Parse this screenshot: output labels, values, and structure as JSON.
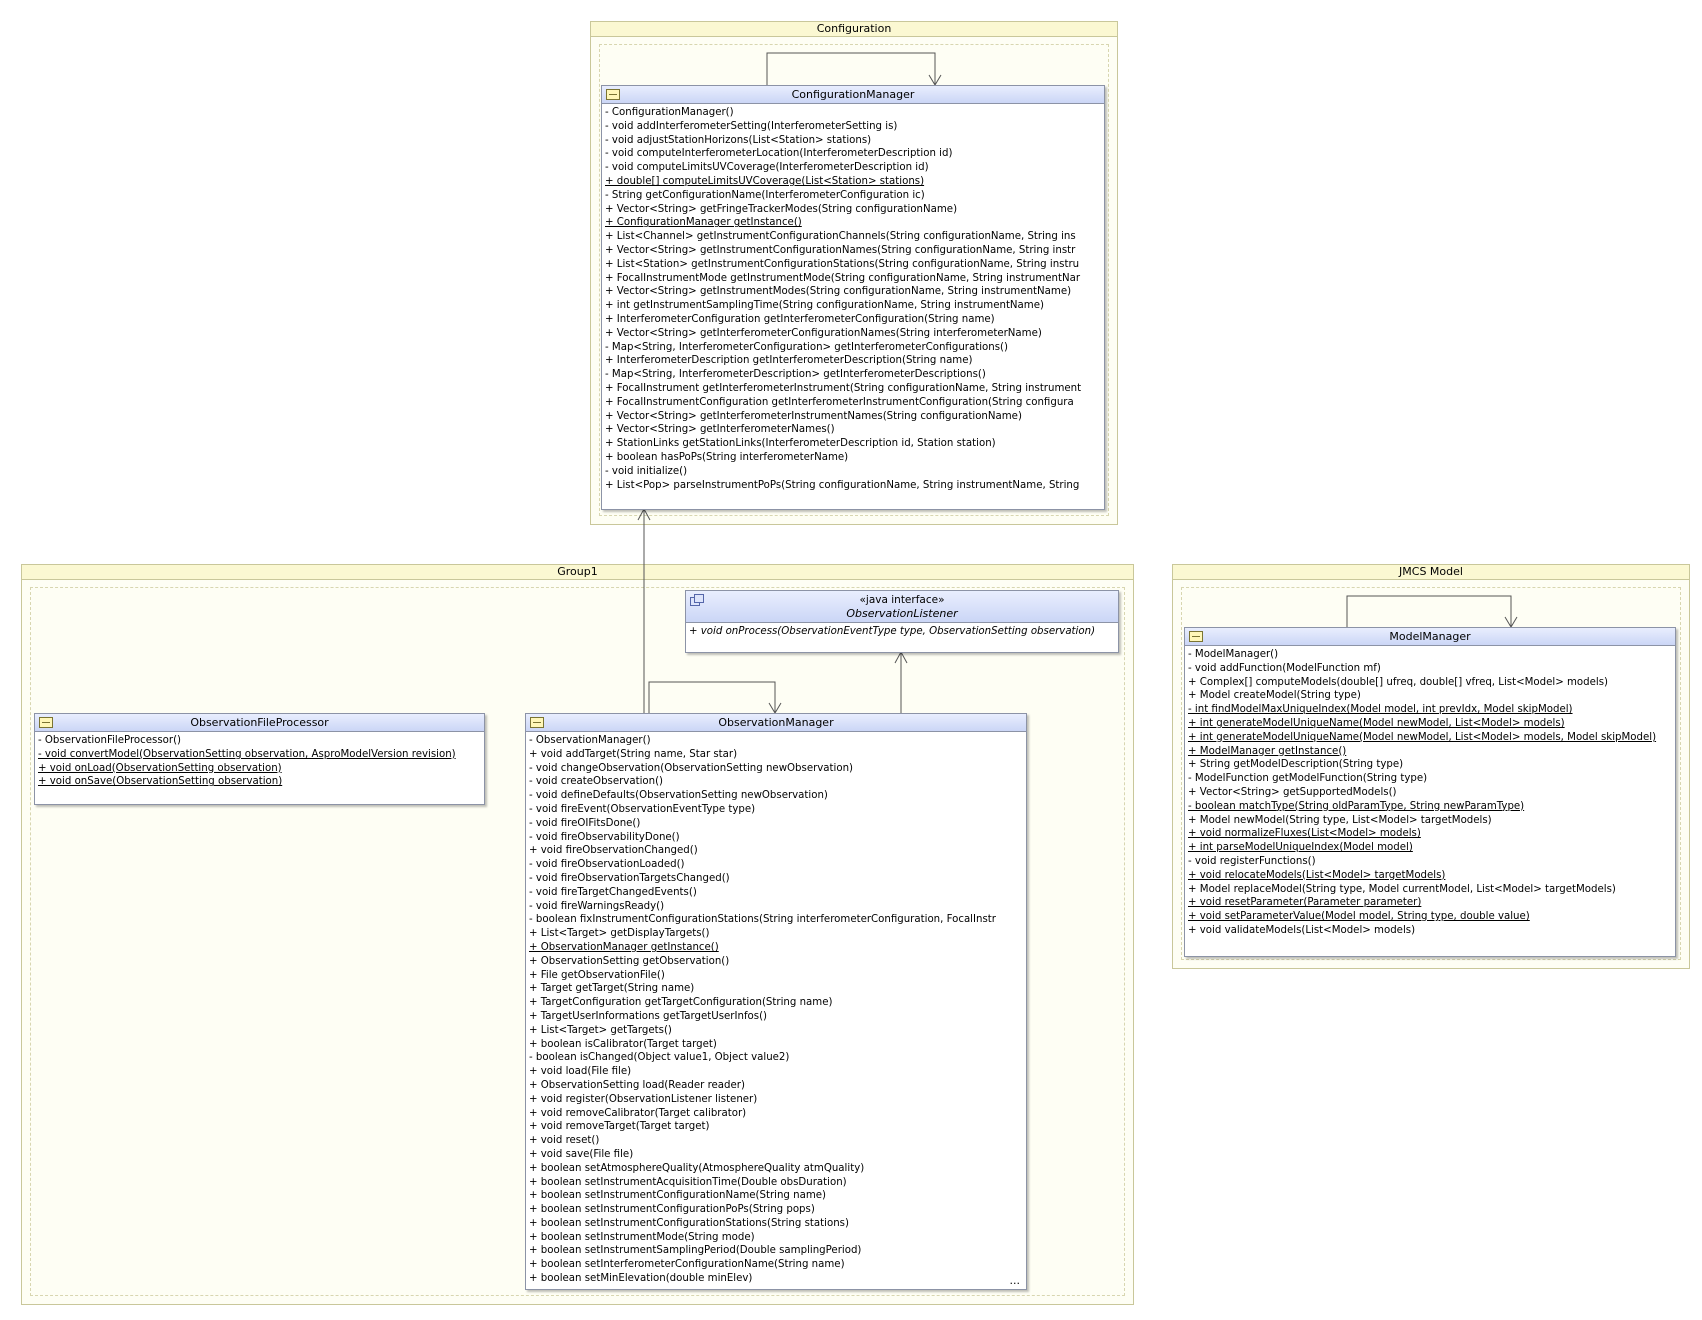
{
  "packages": {
    "configuration": "Configuration",
    "group1": "Group1",
    "jmcs_model": "JMCS Model"
  },
  "colors": {
    "package_fill": "#fefef4",
    "package_title": "#fbf8d2",
    "class_header": "#cbd6f6",
    "class_border": "#8c93a6"
  },
  "configuration_manager": {
    "name": "ConfigurationManager",
    "ops": [
      {
        "t": "- ConfigurationManager()",
        "u": false
      },
      {
        "t": "- void addInterferometerSetting(InterferometerSetting is)",
        "u": false
      },
      {
        "t": "- void adjustStationHorizons(List<Station> stations)",
        "u": false
      },
      {
        "t": "- void computeInterferometerLocation(InterferometerDescription id)",
        "u": false
      },
      {
        "t": "- void computeLimitsUVCoverage(InterferometerDescription id)",
        "u": false
      },
      {
        "t": "+ double[] computeLimitsUVCoverage(List<Station> stations)",
        "u": true
      },
      {
        "t": "- String getConfigurationName(InterferometerConfiguration ic)",
        "u": false
      },
      {
        "t": "+ Vector<String> getFringeTrackerModes(String configurationName)",
        "u": false
      },
      {
        "t": "+ ConfigurationManager getInstance()",
        "u": true
      },
      {
        "t": "+ List<Channel> getInstrumentConfigurationChannels(String configurationName, String ins",
        "u": false
      },
      {
        "t": "+ Vector<String> getInstrumentConfigurationNames(String configurationName, String instr",
        "u": false
      },
      {
        "t": "+ List<Station> getInstrumentConfigurationStations(String configurationName, String instru",
        "u": false
      },
      {
        "t": "+ FocalInstrumentMode getInstrumentMode(String configurationName, String instrumentNar",
        "u": false
      },
      {
        "t": "+ Vector<String> getInstrumentModes(String configurationName, String instrumentName)",
        "u": false
      },
      {
        "t": "+ int getInstrumentSamplingTime(String configurationName, String instrumentName)",
        "u": false
      },
      {
        "t": "+ InterferometerConfiguration getInterferometerConfiguration(String name)",
        "u": false
      },
      {
        "t": "+ Vector<String> getInterferometerConfigurationNames(String interferometerName)",
        "u": false
      },
      {
        "t": "- Map<String, InterferometerConfiguration> getInterferometerConfigurations()",
        "u": false
      },
      {
        "t": "+ InterferometerDescription getInterferometerDescription(String name)",
        "u": false
      },
      {
        "t": "- Map<String, InterferometerDescription> getInterferometerDescriptions()",
        "u": false
      },
      {
        "t": "+ FocalInstrument getInterferometerInstrument(String configurationName, String instrument",
        "u": false
      },
      {
        "t": "+ FocalInstrumentConfiguration getInterferometerInstrumentConfiguration(String configura",
        "u": false
      },
      {
        "t": "+ Vector<String> getInterferometerInstrumentNames(String configurationName)",
        "u": false
      },
      {
        "t": "+ Vector<String> getInterferometerNames()",
        "u": false
      },
      {
        "t": "+ StationLinks getStationLinks(InterferometerDescription id, Station station)",
        "u": false
      },
      {
        "t": "+ boolean hasPoPs(String interferometerName)",
        "u": false
      },
      {
        "t": "- void initialize()",
        "u": false
      },
      {
        "t": "+ List<Pop> parseInstrumentPoPs(String configurationName, String instrumentName, String",
        "u": false
      }
    ]
  },
  "observation_listener": {
    "stereotype": "«java interface»",
    "name": "ObservationListener",
    "ops": [
      {
        "t": "+ void onProcess(ObservationEventType type, ObservationSetting observation)",
        "u": false
      }
    ]
  },
  "observation_file_processor": {
    "name": "ObservationFileProcessor",
    "ops": [
      {
        "t": "- ObservationFileProcessor()",
        "u": false
      },
      {
        "t": "- void convertModel(ObservationSetting observation, AsproModelVersion revision)",
        "u": true
      },
      {
        "t": "+ void onLoad(ObservationSetting observation)",
        "u": true
      },
      {
        "t": "+ void onSave(ObservationSetting observation)",
        "u": true
      }
    ]
  },
  "observation_manager": {
    "name": "ObservationManager",
    "more": "...",
    "ops": [
      {
        "t": "- ObservationManager()",
        "u": false
      },
      {
        "t": "+ void addTarget(String name, Star star)",
        "u": false
      },
      {
        "t": "- void changeObservation(ObservationSetting newObservation)",
        "u": false
      },
      {
        "t": "- void createObservation()",
        "u": false
      },
      {
        "t": "- void defineDefaults(ObservationSetting newObservation)",
        "u": false
      },
      {
        "t": "- void fireEvent(ObservationEventType type)",
        "u": false
      },
      {
        "t": "- void fireOIFitsDone()",
        "u": false
      },
      {
        "t": "- void fireObservabilityDone()",
        "u": false
      },
      {
        "t": "+ void fireObservationChanged()",
        "u": false
      },
      {
        "t": "- void fireObservationLoaded()",
        "u": false
      },
      {
        "t": "- void fireObservationTargetsChanged()",
        "u": false
      },
      {
        "t": "- void fireTargetChangedEvents()",
        "u": false
      },
      {
        "t": "- void fireWarningsReady()",
        "u": false
      },
      {
        "t": "- boolean fixInstrumentConfigurationStations(String interferometerConfiguration, FocalInstr",
        "u": false
      },
      {
        "t": "+ List<Target> getDisplayTargets()",
        "u": false
      },
      {
        "t": "+ ObservationManager getInstance()",
        "u": true
      },
      {
        "t": "+ ObservationSetting getObservation()",
        "u": false
      },
      {
        "t": "+ File getObservationFile()",
        "u": false
      },
      {
        "t": "+ Target getTarget(String name)",
        "u": false
      },
      {
        "t": "+ TargetConfiguration getTargetConfiguration(String name)",
        "u": false
      },
      {
        "t": "+ TargetUserInformations getTargetUserInfos()",
        "u": false
      },
      {
        "t": "+ List<Target> getTargets()",
        "u": false
      },
      {
        "t": "+ boolean isCalibrator(Target target)",
        "u": false
      },
      {
        "t": "- boolean isChanged(Object value1, Object value2)",
        "u": false
      },
      {
        "t": "+ void load(File file)",
        "u": false
      },
      {
        "t": "+ ObservationSetting load(Reader reader)",
        "u": false
      },
      {
        "t": "+ void register(ObservationListener listener)",
        "u": false
      },
      {
        "t": "+ void removeCalibrator(Target calibrator)",
        "u": false
      },
      {
        "t": "+ void removeTarget(Target target)",
        "u": false
      },
      {
        "t": "+ void reset()",
        "u": false
      },
      {
        "t": "+ void save(File file)",
        "u": false
      },
      {
        "t": "+ boolean setAtmosphereQuality(AtmosphereQuality atmQuality)",
        "u": false
      },
      {
        "t": "+ boolean setInstrumentAcquisitionTime(Double obsDuration)",
        "u": false
      },
      {
        "t": "+ boolean setInstrumentConfigurationName(String name)",
        "u": false
      },
      {
        "t": "+ boolean setInstrumentConfigurationPoPs(String pops)",
        "u": false
      },
      {
        "t": "+ boolean setInstrumentConfigurationStations(String stations)",
        "u": false
      },
      {
        "t": "+ boolean setInstrumentMode(String mode)",
        "u": false
      },
      {
        "t": "+ boolean setInstrumentSamplingPeriod(Double samplingPeriod)",
        "u": false
      },
      {
        "t": "+ boolean setInterferometerConfigurationName(String name)",
        "u": false
      },
      {
        "t": "+ boolean setMinElevation(double minElev)",
        "u": false
      }
    ]
  },
  "model_manager": {
    "name": "ModelManager",
    "ops": [
      {
        "t": "- ModelManager()",
        "u": false
      },
      {
        "t": "- void addFunction(ModelFunction mf)",
        "u": false
      },
      {
        "t": "+ Complex[] computeModels(double[] ufreq, double[] vfreq, List<Model> models)",
        "u": false
      },
      {
        "t": "+ Model createModel(String type)",
        "u": false
      },
      {
        "t": "- int findModelMaxUniqueIndex(Model model, int prevIdx, Model skipModel)",
        "u": true
      },
      {
        "t": "+ int generateModelUniqueName(Model newModel, List<Model> models)",
        "u": true
      },
      {
        "t": "+ int generateModelUniqueName(Model newModel, List<Model> models, Model skipModel)",
        "u": true
      },
      {
        "t": "+ ModelManager getInstance()",
        "u": true
      },
      {
        "t": "+ String getModelDescription(String type)",
        "u": false
      },
      {
        "t": "- ModelFunction getModelFunction(String type)",
        "u": false
      },
      {
        "t": "+ Vector<String> getSupportedModels()",
        "u": false
      },
      {
        "t": "- boolean matchType(String oldParamType, String newParamType)",
        "u": true
      },
      {
        "t": "+ Model newModel(String type, List<Model> targetModels)",
        "u": false
      },
      {
        "t": "+ void normalizeFluxes(List<Model> models)",
        "u": true
      },
      {
        "t": "+ int parseModelUniqueIndex(Model model)",
        "u": true
      },
      {
        "t": "- void registerFunctions()",
        "u": false
      },
      {
        "t": "+ void relocateModels(List<Model> targetModels)",
        "u": true
      },
      {
        "t": "+ Model replaceModel(String type, Model currentModel, List<Model> targetModels)",
        "u": false
      },
      {
        "t": "+ void resetParameter(Parameter parameter)",
        "u": true
      },
      {
        "t": "+ void setParameterValue(Model model, String type, double value)",
        "u": true
      },
      {
        "t": "+ void validateModels(List<Model> models)",
        "u": false
      }
    ]
  }
}
